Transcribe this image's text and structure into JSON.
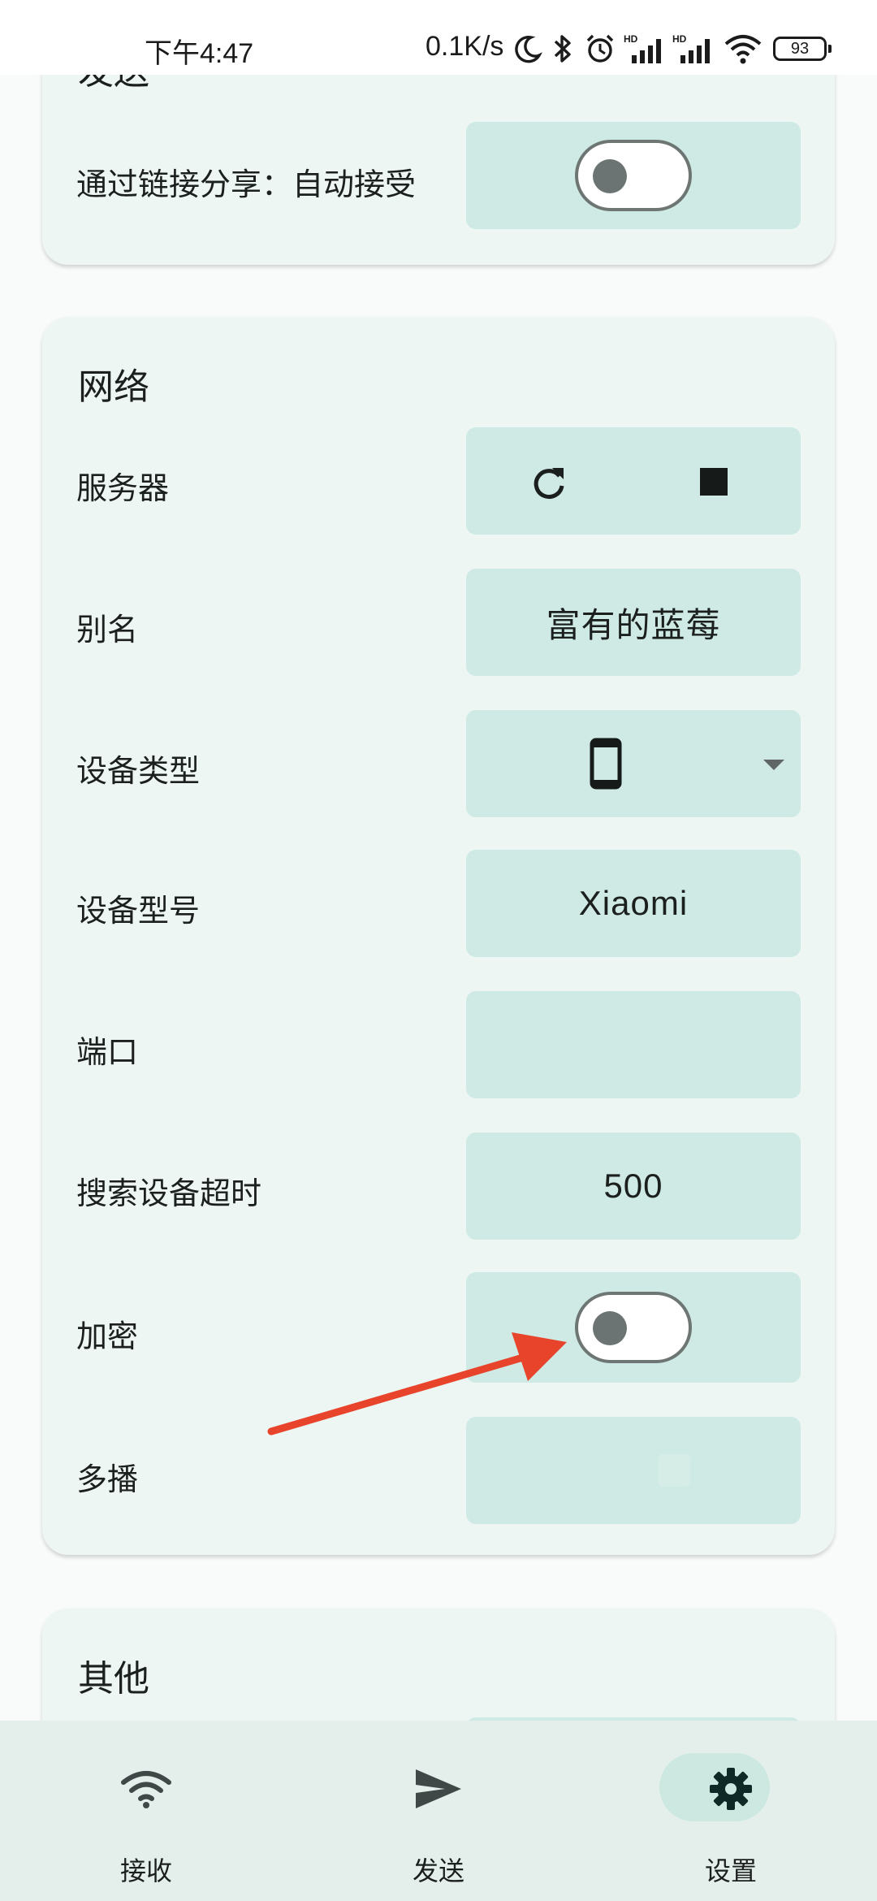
{
  "status": {
    "time": "下午4:47",
    "speed": "0.1K/s",
    "battery": "93"
  },
  "send_section": {
    "title_partial": "发送",
    "share_via_link_label": "通过链接分享：自动接受",
    "share_via_link_on": false
  },
  "network": {
    "title": "网络",
    "server_label": "服务器",
    "alias_label": "别名",
    "alias_value": "富有的蓝莓",
    "device_type_label": "设备类型",
    "device_model_label": "设备型号",
    "device_model_value": "Xiaomi",
    "port_label": "端口",
    "port_value": "",
    "discovery_timeout_label": "搜索设备超时",
    "discovery_timeout_value": "500",
    "encryption_label": "加密",
    "encryption_on": false,
    "multicast_label": "多播"
  },
  "other": {
    "title": "其他"
  },
  "nav": {
    "receive": "接收",
    "send": "发送",
    "settings": "设置",
    "active": "settings"
  },
  "colors": {
    "card_bg": "#eef6f4",
    "control_bg": "#cfeae4",
    "nav_bg": "#e4efec",
    "annotation_arrow": "#e8442b"
  }
}
